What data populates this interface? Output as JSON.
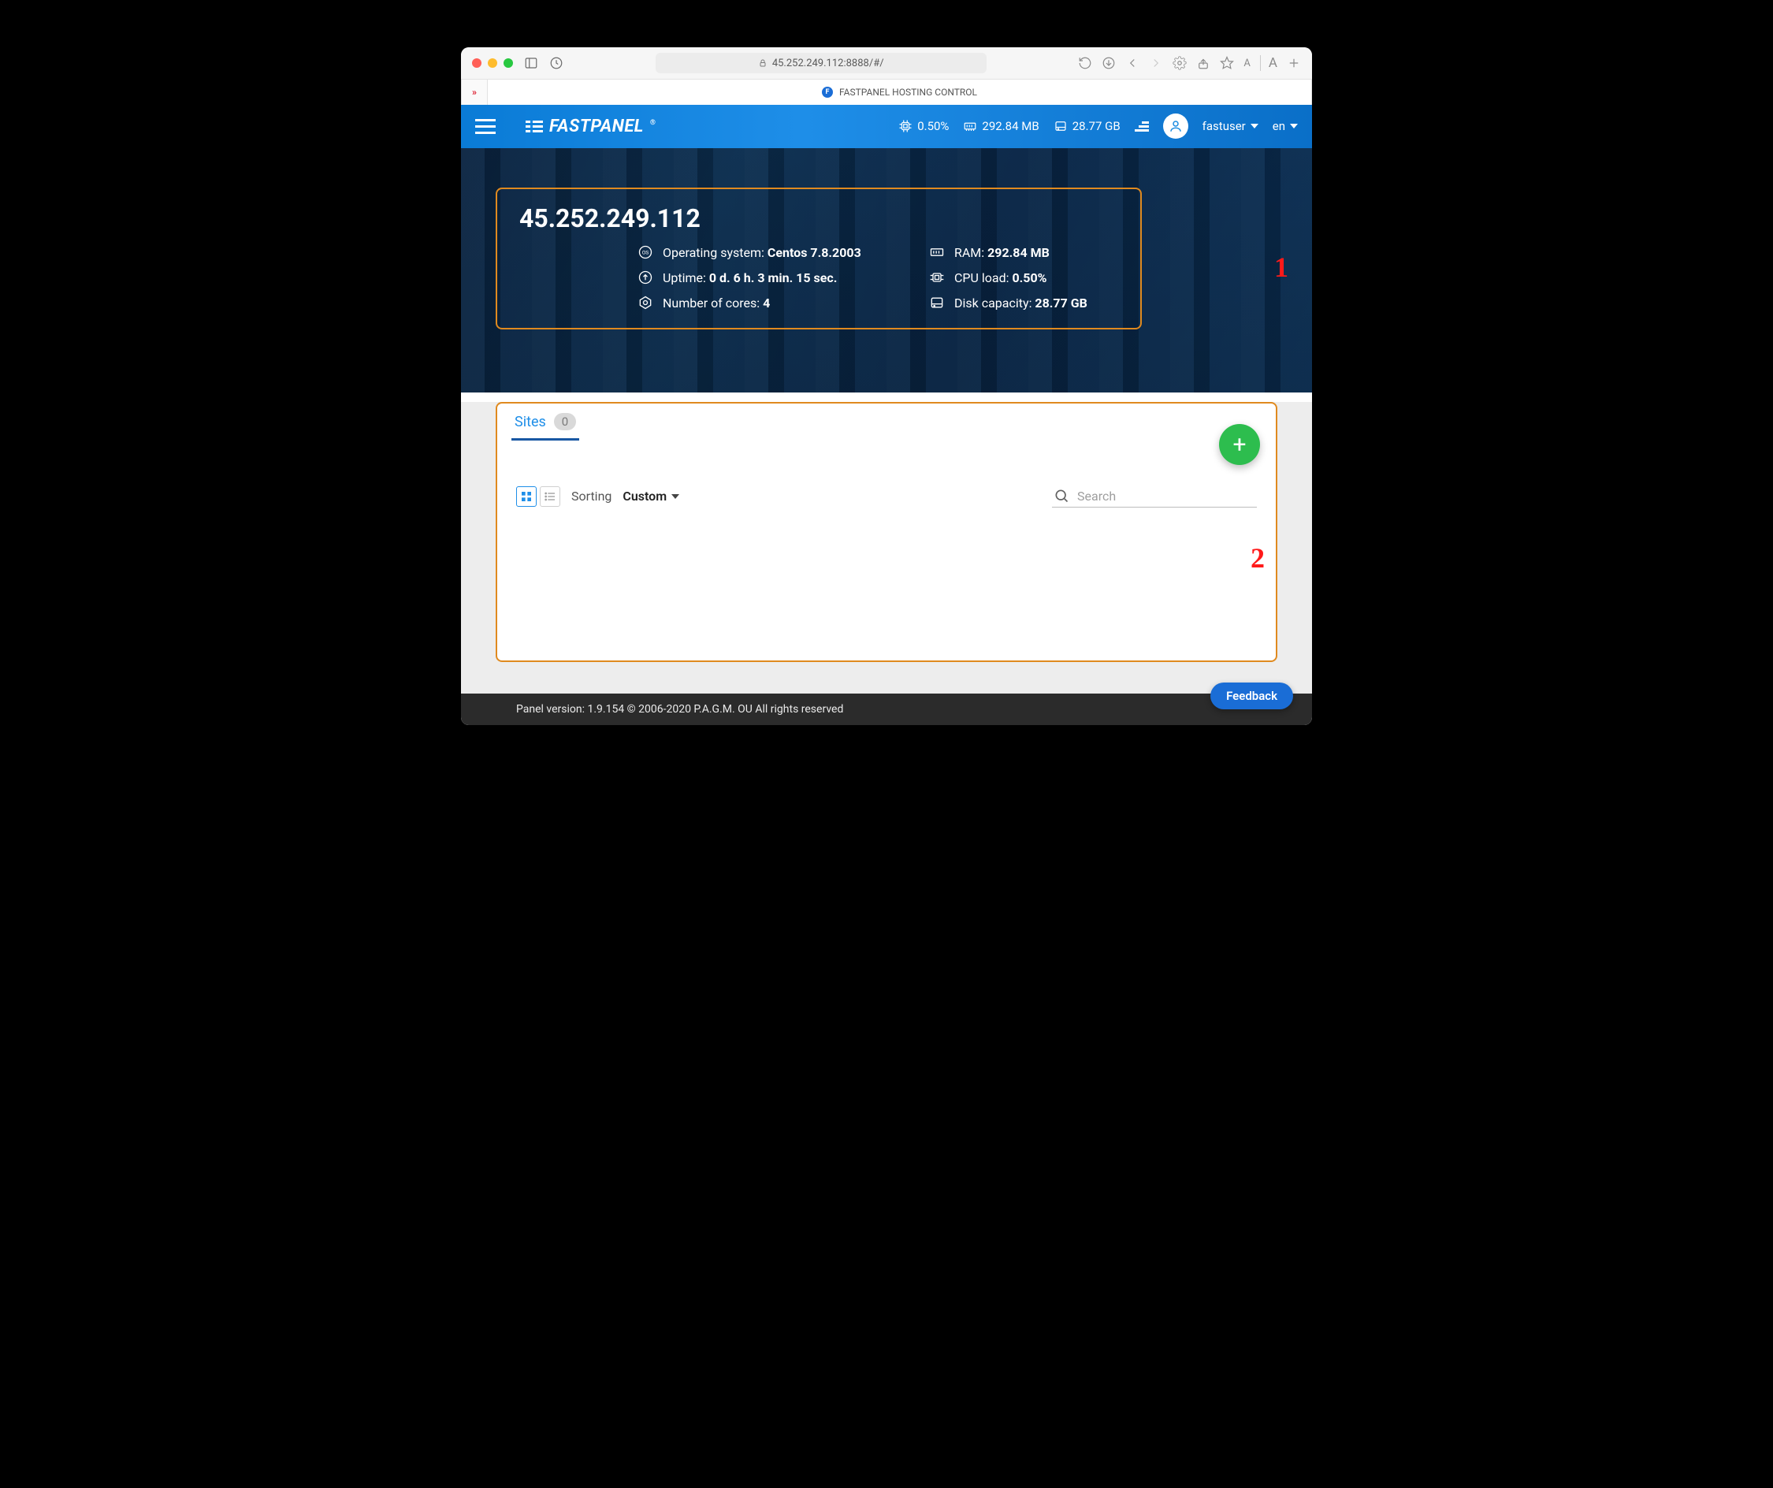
{
  "browser": {
    "url": "45.252.249.112:8888/#/",
    "tab_title": "FASTPANEL HOSTING CONTROL",
    "reader_a": "A",
    "reader_a2": "A"
  },
  "header": {
    "logo_text": "FASTPANEL",
    "logo_reg": "®",
    "cpu": "0.50%",
    "ram": "292.84 MB",
    "disk": "28.77 GB",
    "username": "fastuser",
    "lang": "en"
  },
  "server": {
    "ip": "45.252.249.112",
    "os_label": "Operating system:",
    "os_value": "Centos 7.8.2003",
    "uptime_label": "Uptime:",
    "uptime_value": "0 d. 6 h. 3 min. 15 sec.",
    "cores_label": "Number of cores:",
    "cores_value": "4",
    "ram_label": "RAM:",
    "ram_value": "292.84 MB",
    "cpu_label": "CPU load:",
    "cpu_value": "0.50%",
    "disk_label": "Disk capacity:",
    "disk_value": "28.77 GB"
  },
  "annotations": {
    "one": "1",
    "two": "2"
  },
  "sites": {
    "tab_label": "Sites",
    "count": "0",
    "sorting_label": "Sorting",
    "sorting_value": "Custom",
    "search_placeholder": "Search",
    "add_symbol": "+"
  },
  "footer": {
    "version": "Panel version: 1.9.154 © 2006-2020 P.A.G.M. OU All rights reserved",
    "feedback": "Feedback"
  }
}
